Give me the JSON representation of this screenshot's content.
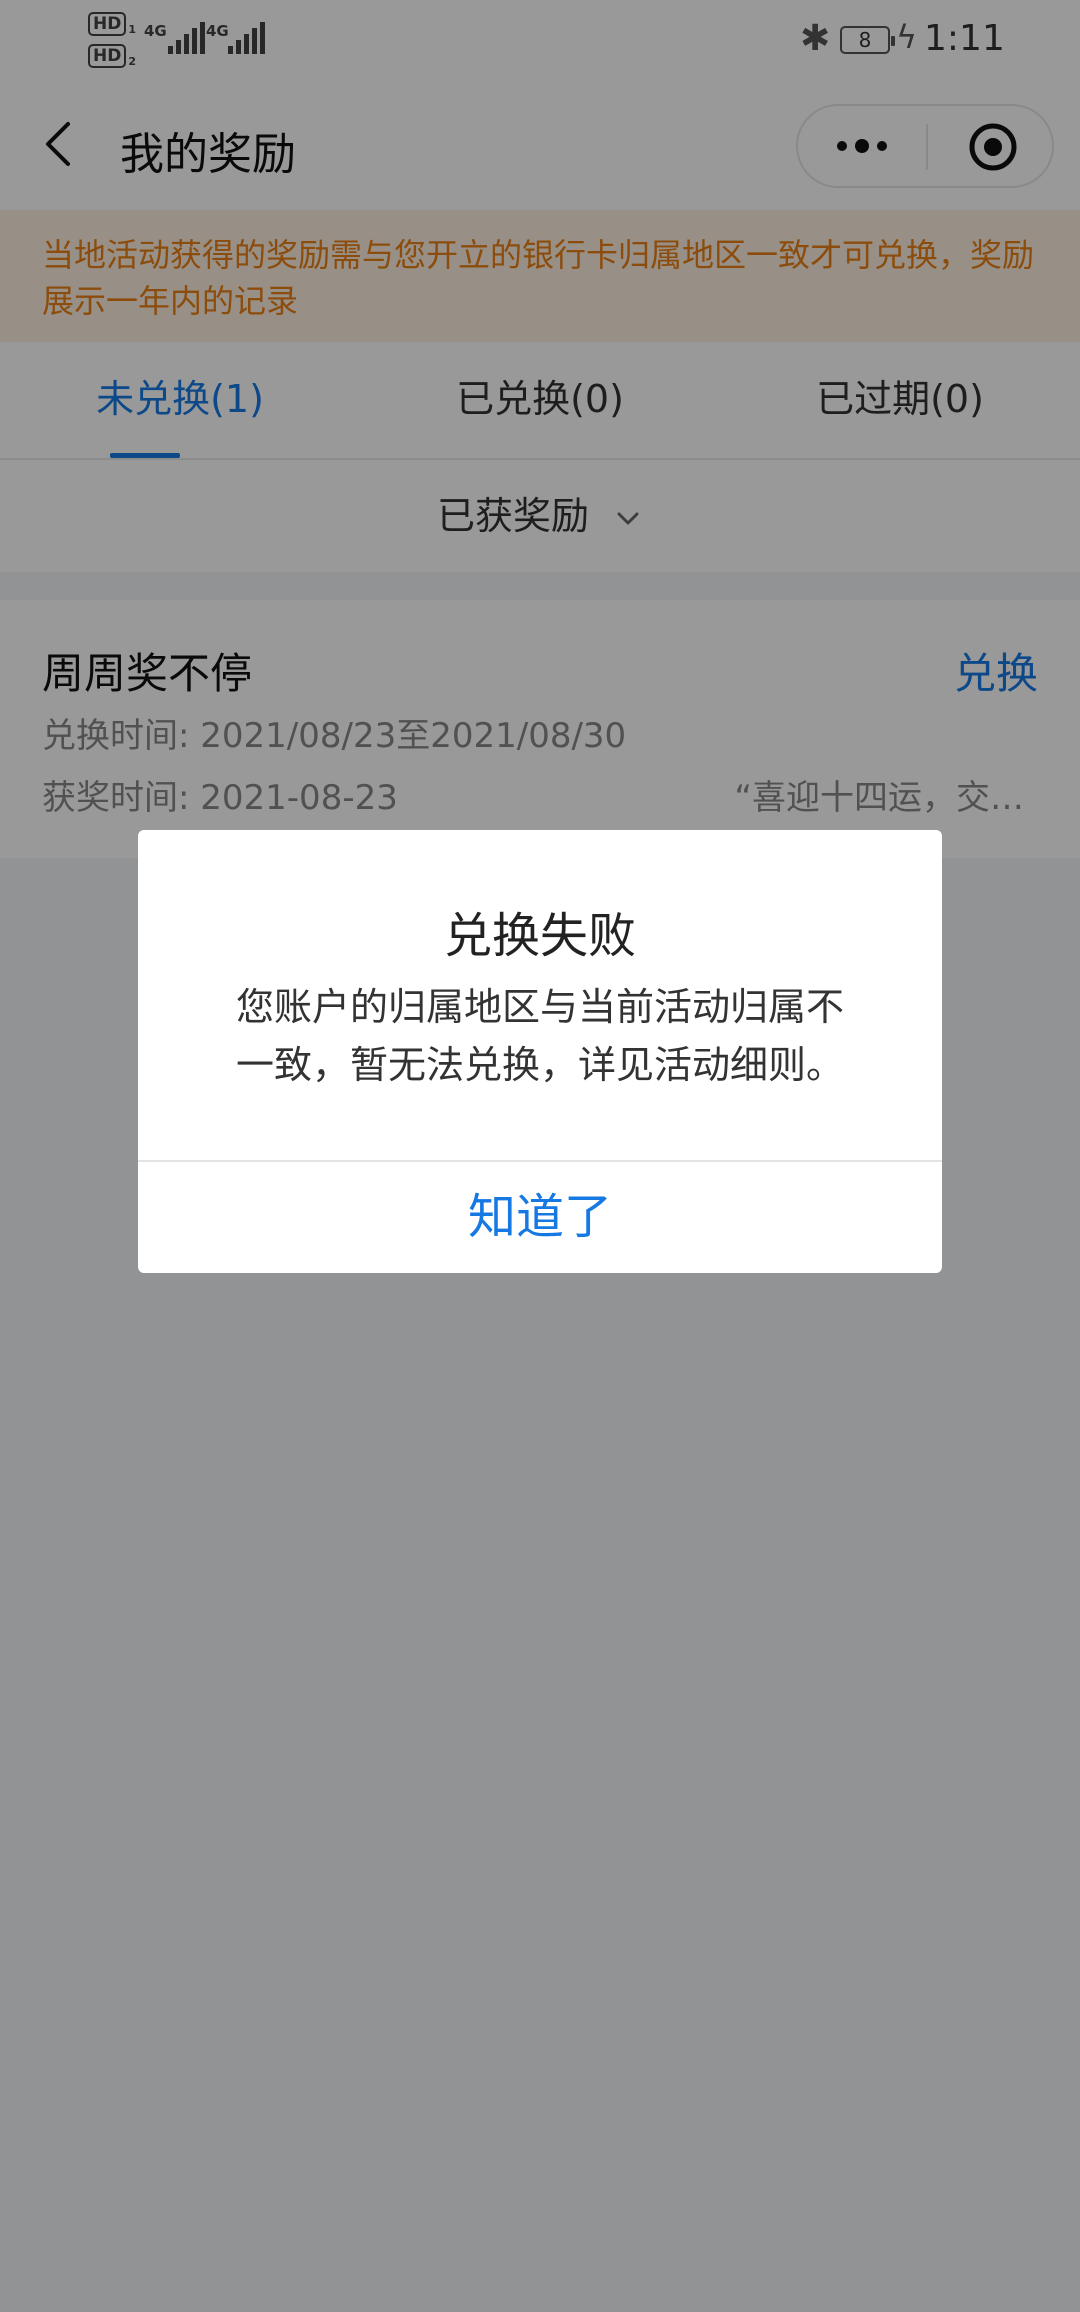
{
  "status_bar": {
    "sim1_label": "HD",
    "sim1_index": "1",
    "sim2_label": "HD",
    "sim2_index": "2",
    "network1": "4G",
    "network2": "4G",
    "battery": "8",
    "time": "1:11"
  },
  "nav": {
    "title": "我的奖励"
  },
  "notice": {
    "text": "当地活动获得的奖励需与您开立的银行卡归属地区一致才可兑换，奖励展示一年内的记录"
  },
  "tabs": [
    {
      "label": "未兑换(1)",
      "active": true
    },
    {
      "label": "已兑换(0)",
      "active": false
    },
    {
      "label": "已过期(0)",
      "active": false
    }
  ],
  "filter": {
    "label": "已获奖励"
  },
  "reward": {
    "name": "周周奖不停",
    "action_label": "兑换",
    "redeem_time": "兑换时间: 2021/08/23至2021/08/30",
    "award_time": "获奖时间: 2021-08-23",
    "activity": "“喜迎十四运，交…"
  },
  "dialog": {
    "title": "兑换失败",
    "message": "您账户的归属地区与当前活动归属不一致，暂无法兑换，详见活动细则。",
    "ok_label": "知道了"
  },
  "colors": {
    "accent": "#1678e3",
    "notice_text": "#e87f14",
    "notice_bg": "#fdf0e1"
  }
}
